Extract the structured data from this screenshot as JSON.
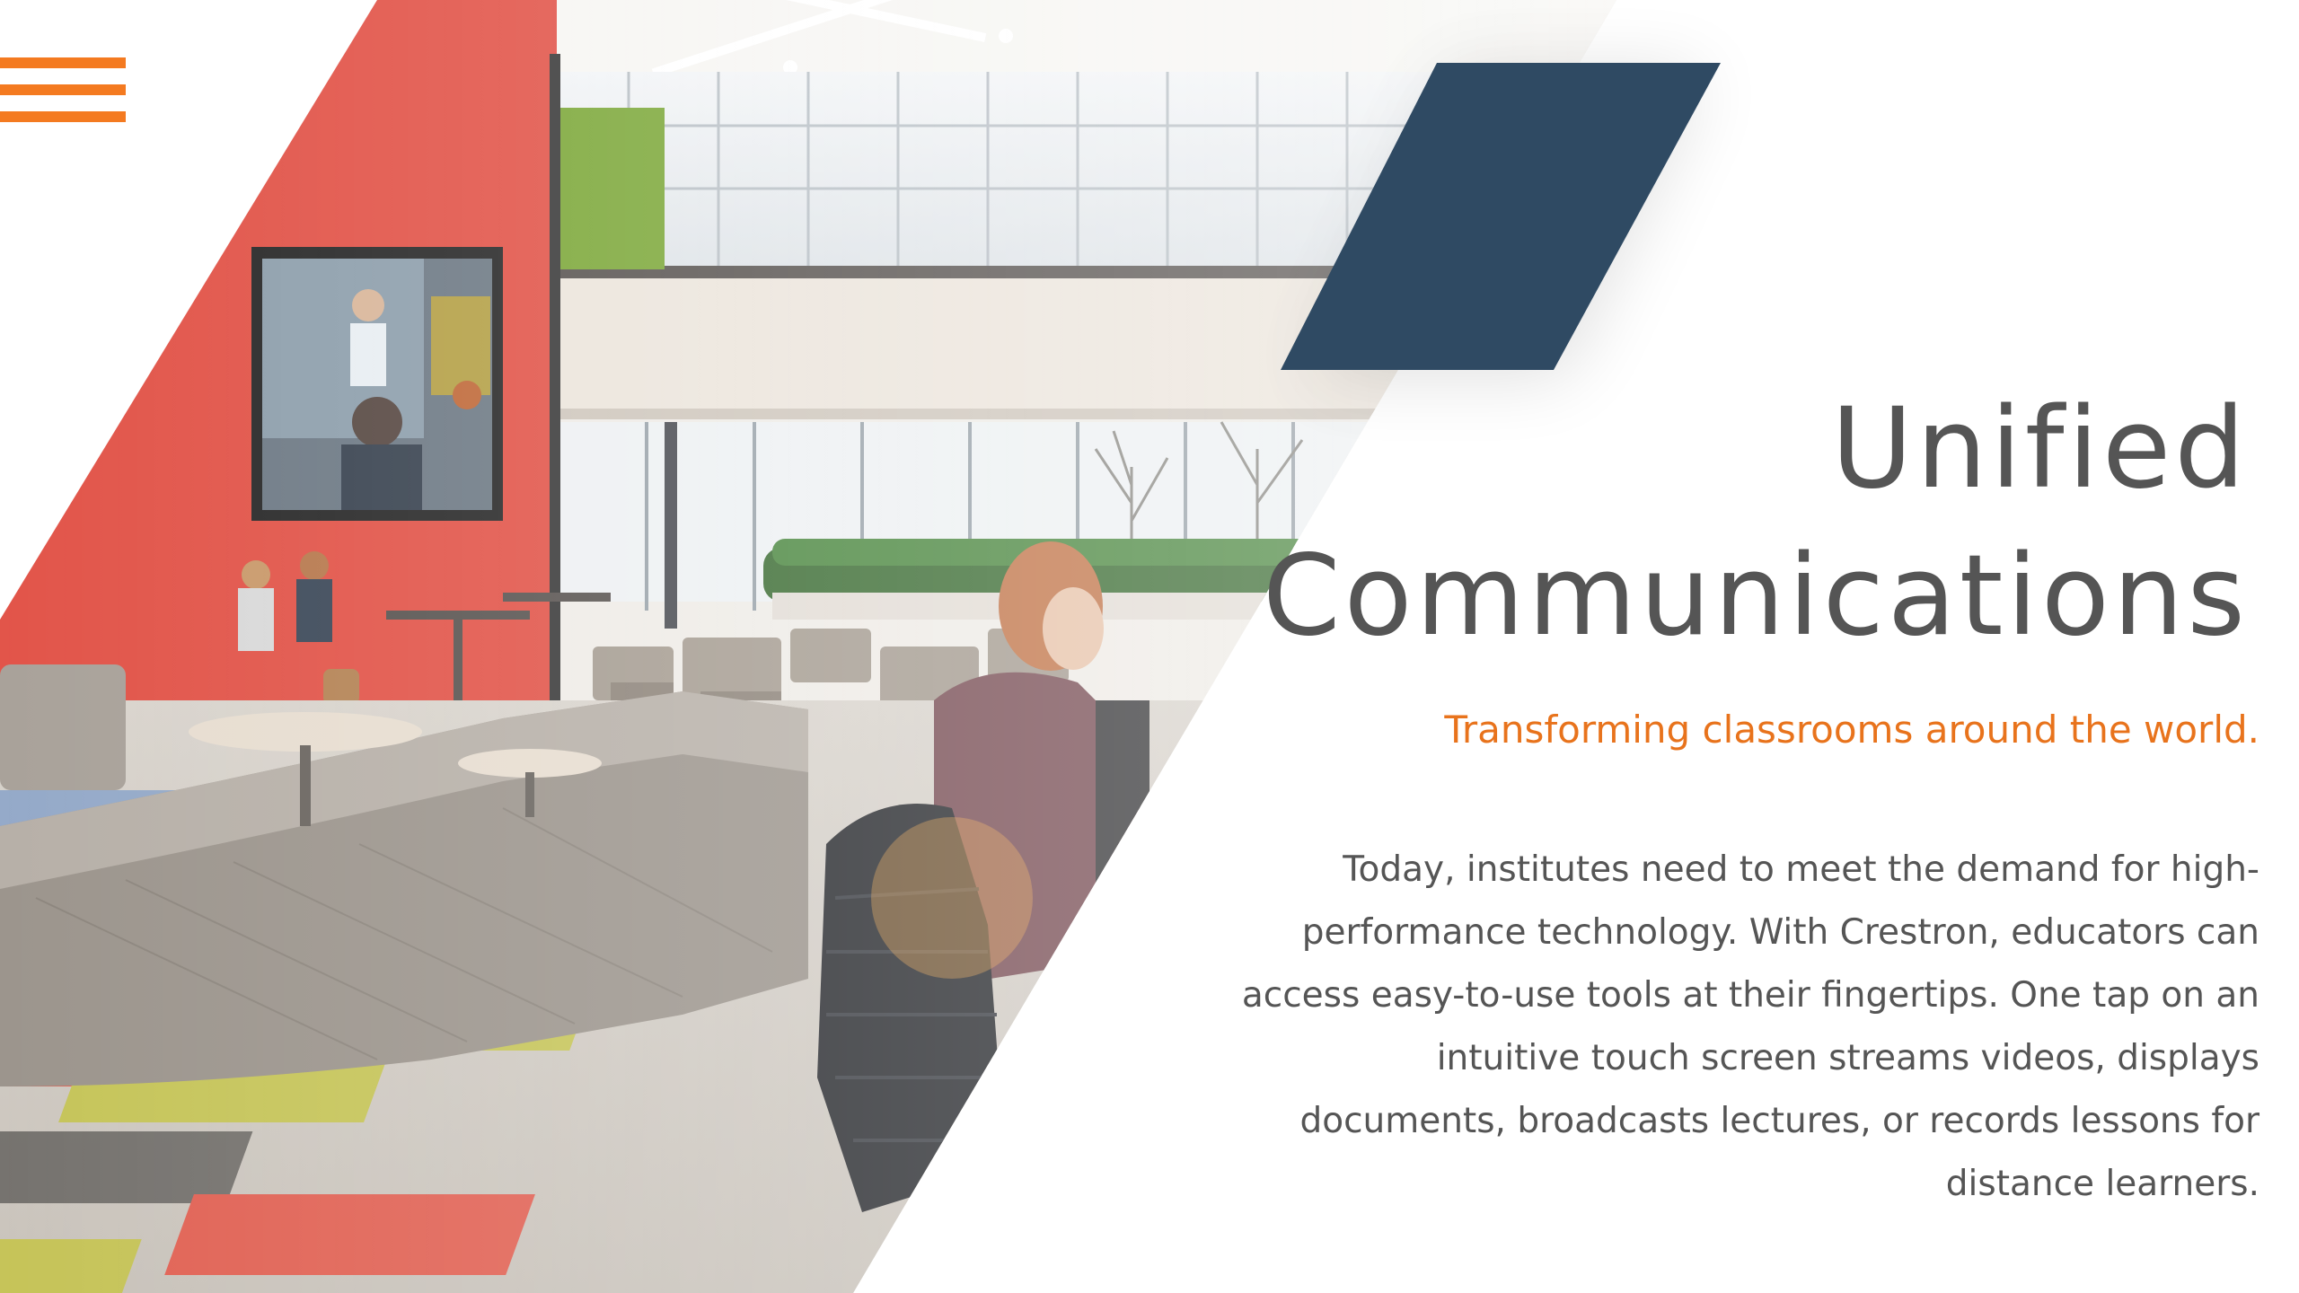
{
  "menu": {
    "icon": "hamburger-menu-icon",
    "color": "#f47a20"
  },
  "hero": {
    "title_line1": "Unified",
    "title_line2": "Communications",
    "subtitle": "Transforming classrooms around the world.",
    "body_lines": [
      "Today, institutes need to meet the demand for high-",
      "performance technology. With Crestron, educators can",
      "access easy-to-use tools at their fingertips. One tap on an",
      "intuitive touch screen streams videos, displays",
      "documents, broadcasts lectures, or records lessons for",
      "distance learners."
    ]
  },
  "colors": {
    "accent_orange": "#f47a20",
    "accent_navy": "#2f4a63",
    "title_gray": "#555555",
    "wall_red": "#e2554a",
    "wall_green": "#7da83a"
  }
}
